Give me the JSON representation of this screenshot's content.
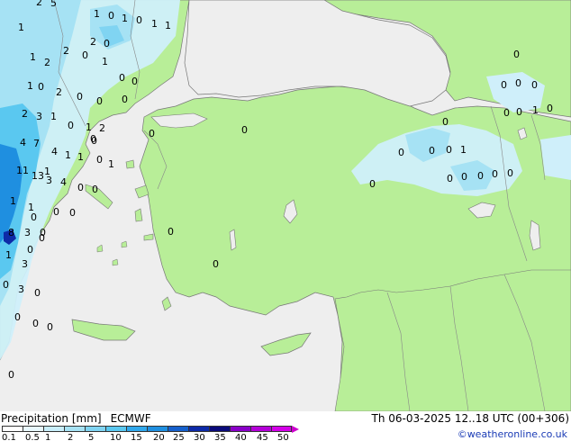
{
  "title": "Precipitation [mm]",
  "model": "ECMWF",
  "valid": "Th 06-03-2025 12..18 UTC (00+306)",
  "credit": "©weatheronline.co.uk",
  "colors": {
    "sea": "#eeeeee",
    "land": "#b8ee98",
    "coast": "#777777",
    "border": "#888888",
    "precip_light": "#cfeffa",
    "precip_mid": "#a6e2f4",
    "precip_heavy": "#5ac8f0",
    "precip_strong": "#1f8fe0",
    "precip_max": "#0d2aa8"
  },
  "legend": {
    "ticks": [
      "0.1",
      "0.5",
      "1",
      "2",
      "5",
      "10",
      "15",
      "20",
      "25",
      "30",
      "35",
      "40",
      "45",
      "50"
    ],
    "swatches": [
      "#ffffff",
      "#e8f8fd",
      "#c8eefa",
      "#a6e2f4",
      "#80d4f2",
      "#5ac8f0",
      "#30a8ec",
      "#1f8fe0",
      "#1660cc",
      "#0d2aa8",
      "#0b0b7a",
      "#8a00c8",
      "#b400d8",
      "#d400e8"
    ]
  },
  "value_labels": [
    {
      "t": "2"
    },
    {
      "t": "5"
    },
    {
      "t": "1"
    },
    {
      "t": "0"
    },
    {
      "t": "1"
    },
    {
      "t": "0"
    },
    {
      "t": "1"
    },
    {
      "t": "1"
    },
    {
      "t": "1"
    },
    {
      "t": "2"
    },
    {
      "t": "0"
    },
    {
      "t": "2"
    },
    {
      "t": "0"
    },
    {
      "t": "1"
    },
    {
      "t": "1"
    },
    {
      "t": "2"
    },
    {
      "t": "0"
    },
    {
      "t": "0"
    },
    {
      "t": "1"
    },
    {
      "t": "0"
    },
    {
      "t": "2"
    },
    {
      "t": "0"
    },
    {
      "t": "0"
    },
    {
      "t": "0"
    },
    {
      "t": "2"
    },
    {
      "t": "3"
    },
    {
      "t": "1"
    },
    {
      "t": "0"
    },
    {
      "t": "1"
    },
    {
      "t": "2"
    },
    {
      "t": "0"
    },
    {
      "t": "0"
    },
    {
      "t": "0"
    },
    {
      "t": "4"
    },
    {
      "t": "7"
    },
    {
      "t": "4"
    },
    {
      "t": "1"
    },
    {
      "t": "1"
    },
    {
      "t": "0"
    },
    {
      "t": "1"
    },
    {
      "t": "11"
    },
    {
      "t": "13"
    },
    {
      "t": "1"
    },
    {
      "t": "3"
    },
    {
      "t": "4"
    },
    {
      "t": "0"
    },
    {
      "t": "0"
    },
    {
      "t": "1"
    },
    {
      "t": "1"
    },
    {
      "t": "0"
    },
    {
      "t": "0"
    },
    {
      "t": "0"
    },
    {
      "t": "0"
    },
    {
      "t": "8"
    },
    {
      "t": "3"
    },
    {
      "t": "0"
    },
    {
      "t": "0"
    },
    {
      "t": "1"
    },
    {
      "t": "3"
    },
    {
      "t": "0"
    },
    {
      "t": "3"
    },
    {
      "t": "0"
    },
    {
      "t": "0"
    },
    {
      "t": "0"
    },
    {
      "t": "0"
    },
    {
      "t": "0"
    },
    {
      "t": "0"
    },
    {
      "t": "0"
    },
    {
      "t": "0"
    },
    {
      "t": "0"
    },
    {
      "t": "0"
    },
    {
      "t": "0"
    },
    {
      "t": "0"
    },
    {
      "t": "1"
    },
    {
      "t": "0"
    },
    {
      "t": "0"
    },
    {
      "t": "0"
    },
    {
      "t": "0"
    },
    {
      "t": "1"
    },
    {
      "t": "0"
    },
    {
      "t": "0"
    },
    {
      "t": "0"
    },
    {
      "t": "0"
    },
    {
      "t": "0"
    },
    {
      "t": "0"
    },
    {
      "t": "0"
    },
    {
      "t": "0"
    },
    {
      "t": "0"
    }
  ]
}
